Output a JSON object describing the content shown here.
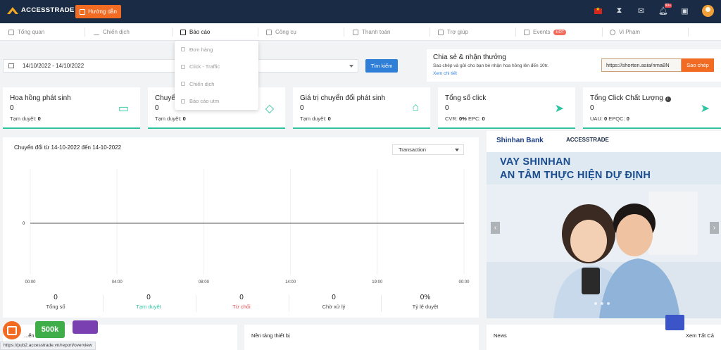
{
  "topbar": {
    "logo": "ACCESSTRADE",
    "guide_button": "Hướng dẫn",
    "notification_badge": "99+"
  },
  "nav": {
    "items": [
      "Tổng quan",
      "Chiến dịch",
      "Báo cáo",
      "Công cụ",
      "Thanh toán",
      "Trợ giúp",
      "Events",
      "Vi Phạm"
    ],
    "events_badge": "HOT",
    "active": "Báo cáo"
  },
  "report_menu": {
    "items": [
      "Đơn hàng",
      "Click - Traffic",
      "Chiến dịch",
      "Báo cáo utm"
    ]
  },
  "filter": {
    "date_range": "14/10/2022 - 14/10/2022",
    "search_button": "Tìm kiếm"
  },
  "share": {
    "title": "Chia sẻ & nhận thưởng",
    "desc": "Sao chép và gửi cho bạn bè nhận hoa hồng lên đến 10tr.",
    "more_link": "Xem chi tiết",
    "url": "https://shorten.asia/nma8N",
    "copy_button": "Sao chép"
  },
  "cards": [
    {
      "title": "Hoa hồng phát sinh",
      "value": "0",
      "sub": "Tạm duyệt: ",
      "sub_value": "0",
      "icon": "wallet-icon"
    },
    {
      "title": "Chuyể",
      "value": "0",
      "sub": "Tạm duyệt: ",
      "sub_value": "0",
      "icon": "diamond-icon"
    },
    {
      "title": "Giá trị chuyển đổi phát sinh",
      "value": "0",
      "sub": "Tạm duyệt: ",
      "sub_value": "0",
      "icon": "bag-icon"
    },
    {
      "title": "Tổng số click",
      "value": "0",
      "sub": "CVR: ",
      "sub_value": "0%",
      "sub2": "EPC: ",
      "sub2_value": "0",
      "icon": "send-icon"
    },
    {
      "title": "Tổng Click Chất Lượng",
      "value": "0",
      "sub": "UAU: ",
      "sub_value": "0",
      "sub2": "EPQC: ",
      "sub2_value": "0",
      "icon": "send-icon"
    }
  ],
  "chart_panel": {
    "title": "Chuyển đổi từ 14-10-2022 đến 14-10-2022",
    "select": "Transaction"
  },
  "chart_data": {
    "type": "line",
    "x": [
      "00:00",
      "04:00",
      "08:00",
      "14:00",
      "19:00",
      "00:00"
    ],
    "series": [
      {
        "values": [
          0,
          0,
          0,
          0,
          0,
          0
        ]
      }
    ],
    "yticks": [
      "0"
    ],
    "title": "Chuyển đổi từ 14-10-2022 đến 14-10-2022",
    "grid": true,
    "color": "#555555"
  },
  "stats": [
    {
      "value": "0",
      "label": "Tổng số",
      "color": "#444444"
    },
    {
      "value": "0",
      "label": "Tạm duyệt",
      "color": "#2ec4a0"
    },
    {
      "value": "0",
      "label": "Từ chối",
      "color": "#e8484f"
    },
    {
      "value": "0",
      "label": "Chờ xử lý",
      "color": "#444444"
    },
    {
      "value": "0%",
      "label": "Tỷ lệ duyệt",
      "color": "#444444"
    }
  ],
  "banner": {
    "bank": "Shinhan Bank",
    "partner": "ACCESSTRADE",
    "headline1": "VAY SHINHAN",
    "headline2": "AN TÂM THỰC HIỆN DỰ ĐỊNH"
  },
  "bottom": {
    "panel1": "...ển đổi",
    "panel2": "Nền tảng thiết bị",
    "panel3": "News",
    "view_all": "Xem Tất Cả"
  },
  "status_url": "https://pub2.accesstrade.vn/report/overview",
  "promo": {
    "amount": "500k"
  }
}
